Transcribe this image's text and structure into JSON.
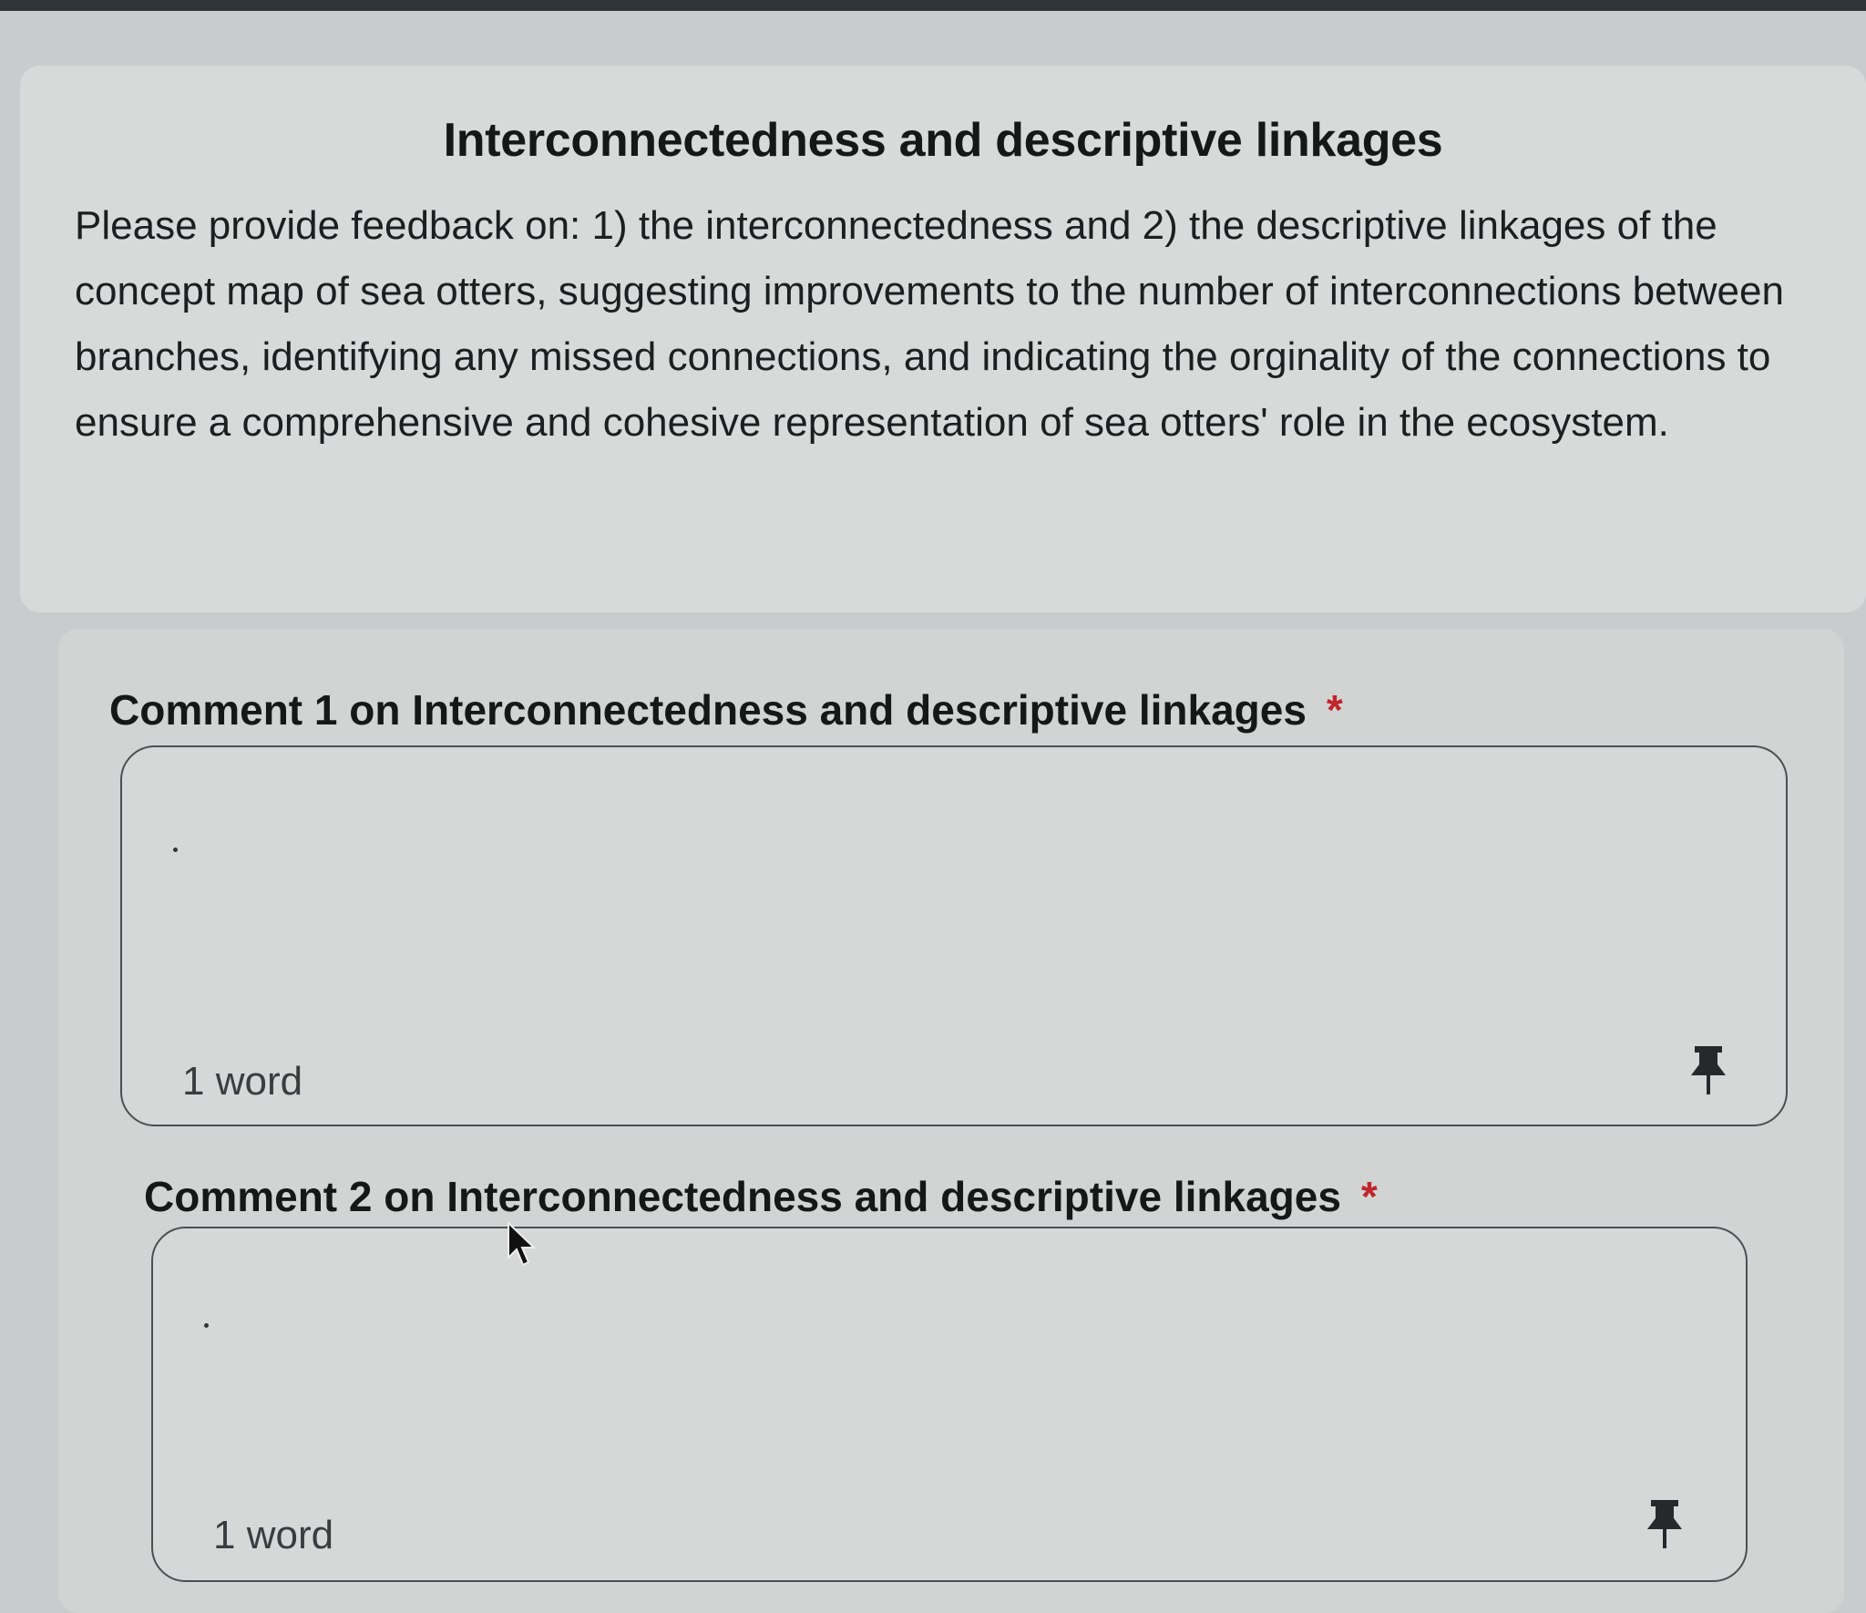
{
  "section": {
    "title": "Interconnectedness and descriptive linkages",
    "description": "Please provide feedback on: 1) the interconnectedness and 2) the descriptive linkages of the concept map of sea otters, suggesting improvements to the number of interconnections between branches, identifying any missed connections, and indicating the orginality of the connections to ensure a comprehensive and cohesive representation of sea otters' role in the ecosystem."
  },
  "questions": [
    {
      "label": "Comment 1 on Interconnectedness and descriptive linkages",
      "required_marker": "*",
      "value": "",
      "word_count": "1 word",
      "pin_icon": "pushpin-icon"
    },
    {
      "label": "Comment 2 on Interconnectedness and descriptive linkages",
      "required_marker": "*",
      "value": "",
      "word_count": "1 word",
      "pin_icon": "pushpin-icon"
    }
  ],
  "colors": {
    "required": "#c0262b",
    "text": "#161818",
    "card": "#d8dad9"
  },
  "cursor_icon": "mouse-pointer-icon"
}
